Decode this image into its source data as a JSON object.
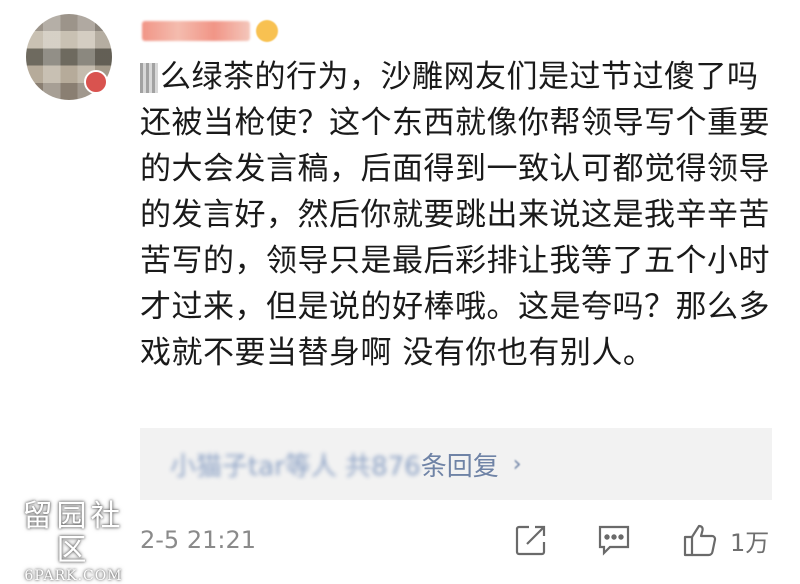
{
  "post": {
    "comment_text": "么绿茶的行为，沙雕网友们是过节过傻了吗还被当枪使？这个东西就像你帮领导写个重要的大会发言稿，后面得到一致认可都觉得领导的发言好，然后你就要跳出来说这是我辛辛苦苦写的，领导只是最后彩排让我等了五个小时才过来，但是说的好棒哦。这是夸吗？那么多戏就不要当替身啊 没有你也有别人。",
    "replies_link_blurred": "小猫子tar等人 共876",
    "replies_link_suffix": "条回复",
    "replies_arrow": "›",
    "timestamp": "2-5 21:21",
    "like_count": "1万"
  },
  "watermark": {
    "cn": "留园社区",
    "en": "6PARK.COM"
  },
  "icons": {
    "share": "share-icon",
    "comment": "comment-icon",
    "like": "thumbs-up-icon"
  },
  "colors": {
    "link": "#6f83a6",
    "reply_bg": "#f2f2f2",
    "meta": "#8a8a8a"
  }
}
